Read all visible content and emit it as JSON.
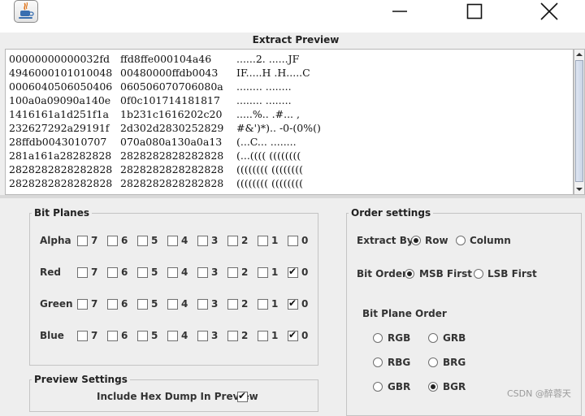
{
  "window": {
    "app_icon": "java-cup-icon"
  },
  "preview": {
    "title": "Extract Preview",
    "hex_rows": [
      {
        "a": "00000000000032fd",
        "b": "ffd8ffe000104a46",
        "c": "......2. ......JF"
      },
      {
        "a": "4946000101010048",
        "b": "00480000ffdb0043",
        "c": "IF.....H .H.....C"
      },
      {
        "a": "0006040506050406",
        "b": "060506070706080a",
        "c": "........ ........"
      },
      {
        "a": "100a0a09090a140e",
        "b": "0f0c101714181817",
        "c": "........ ........"
      },
      {
        "a": "1416161a1d251f1a",
        "b": "1b231c1616202c20",
        "c": ".....%.. .#... ,"
      },
      {
        "a": "232627292a29191f",
        "b": "2d302d2830252829",
        "c": "#&')*).. -0-(0%()"
      },
      {
        "a": "28ffdb0043010707",
        "b": "070a080a130a0a13",
        "c": "(...C... ........"
      },
      {
        "a": "281a161a28282828",
        "b": "2828282828282828",
        "c": "(...(((( (((((((("
      },
      {
        "a": "2828282828282828",
        "b": "2828282828282828",
        "c": "(((((((( (((((((("
      },
      {
        "a": "2828282828282828",
        "b": "2828282828282828",
        "c": "(((((((( (((((((("
      }
    ]
  },
  "bit_planes": {
    "title": "Bit Planes",
    "bits": [
      "7",
      "6",
      "5",
      "4",
      "3",
      "2",
      "1",
      "0"
    ],
    "rows": [
      {
        "label": "Alpha",
        "checked": [
          false,
          false,
          false,
          false,
          false,
          false,
          false,
          false
        ]
      },
      {
        "label": "Red",
        "checked": [
          false,
          false,
          false,
          false,
          false,
          false,
          false,
          true
        ]
      },
      {
        "label": "Green",
        "checked": [
          false,
          false,
          false,
          false,
          false,
          false,
          false,
          true
        ]
      },
      {
        "label": "Blue",
        "checked": [
          false,
          false,
          false,
          false,
          false,
          false,
          false,
          true
        ]
      }
    ]
  },
  "preview_settings": {
    "title": "Preview Settings",
    "include_hex_label": "Include Hex Dump In Preview",
    "include_hex_checked": true
  },
  "order_settings": {
    "title": "Order settings",
    "extract_by_label": "Extract By",
    "extract_by_options": [
      "Row",
      "Column"
    ],
    "extract_by_selected": "Row",
    "bit_order_label": "Bit Order",
    "bit_order_options": [
      "MSB First",
      "LSB First"
    ],
    "bit_order_selected": "MSB First",
    "bit_plane_order_label": "Bit Plane Order",
    "bit_plane_options": [
      "RGB",
      "GRB",
      "RBG",
      "BRG",
      "GBR",
      "BGR"
    ],
    "bit_plane_selected": "BGR"
  },
  "watermark": "CSDN @醉蓉天"
}
